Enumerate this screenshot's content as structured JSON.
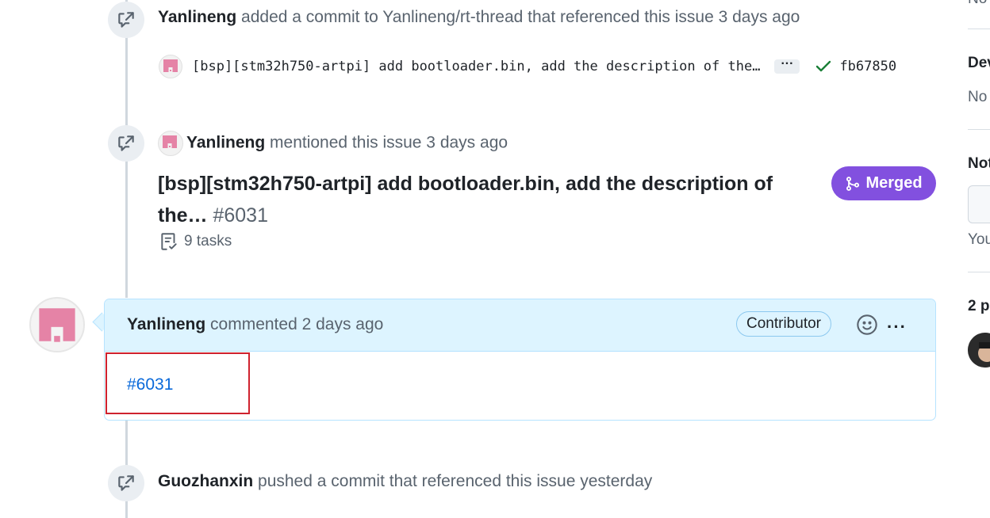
{
  "timeline": {
    "event1": {
      "author": "Yanlineng",
      "text": "added a commit to Yanlineng/rt-thread that referenced this issue 3 days ago",
      "commit_message": "[bsp][stm32h750-artpi] add bootloader.bin, add the description of the…",
      "ellipsis": "···",
      "sha": "fb67850"
    },
    "event2": {
      "author": "Yanlineng",
      "text": "mentioned this issue 3 days ago",
      "pr_title": "[bsp][stm32h750-artpi] add bootloader.bin, add the description of the…",
      "pr_number": "#6031",
      "status_label": "Merged",
      "tasks": "9 tasks"
    },
    "comment": {
      "author": "Yanlineng",
      "text": "commented 2 days ago",
      "role_badge": "Contributor",
      "menu": "···",
      "body_link": "#6031"
    },
    "event3": {
      "author": "Guozhanxin",
      "text": "pushed a commit that referenced this issue yesterday"
    }
  },
  "sidebar": {
    "item1_value": "No",
    "dev_heading": "Dev",
    "dev_value": "No",
    "notif_heading": "Not",
    "notif_text": "You",
    "participants_heading": "2 p"
  },
  "colors": {
    "merged": "#8250df",
    "link": "#0969da",
    "comment_header": "#ddf4ff",
    "avatar_pink": "#e583a6",
    "highlight": "#cf222e"
  }
}
